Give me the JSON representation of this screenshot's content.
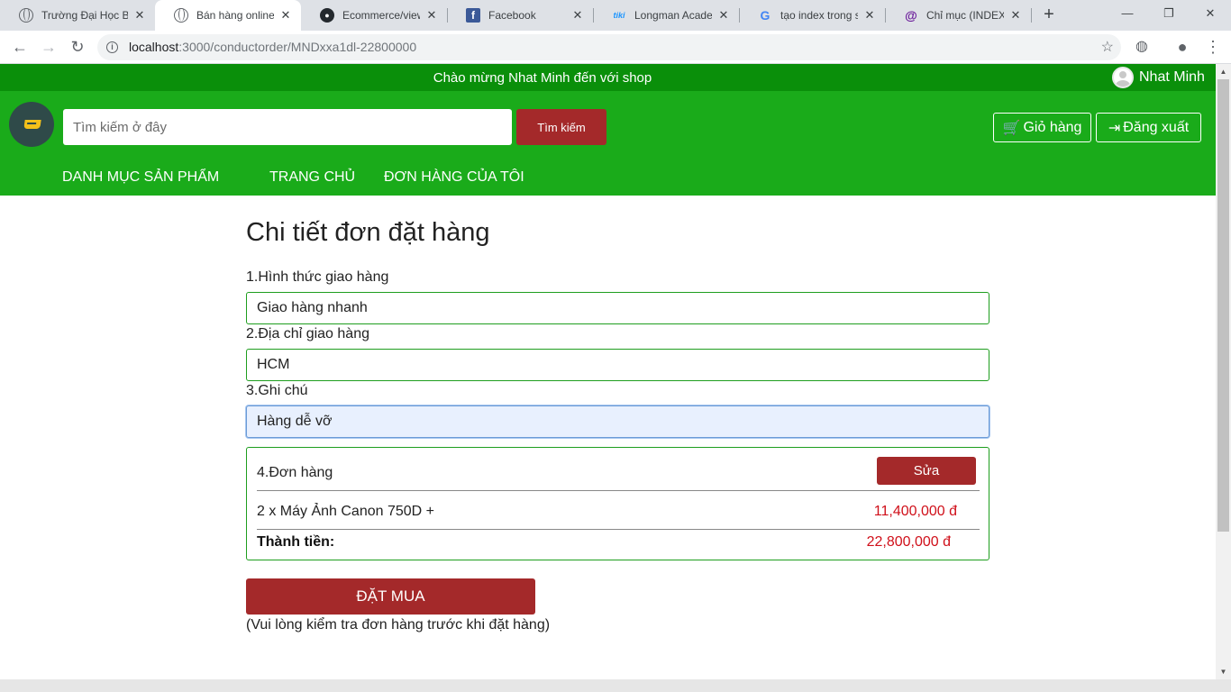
{
  "browser": {
    "tabs": [
      {
        "title": "Trường Đại Học Bá",
        "icon": "globe-icon"
      },
      {
        "title": "Bán hàng online",
        "icon": "globe-icon"
      },
      {
        "title": "Ecommerce/views",
        "icon": "github-icon"
      },
      {
        "title": "Facebook",
        "icon": "facebook-icon"
      },
      {
        "title": "Longman Academ",
        "icon": "tiki-icon"
      },
      {
        "title": "tạo index trong sq",
        "icon": "google-icon"
      },
      {
        "title": "Chỉ mục (INDEX) tr",
        "icon": "at-icon"
      }
    ],
    "url_host": "localhost",
    "url_path": ":3000/conductorder/MNDxxa1dl-22800000"
  },
  "welcome": {
    "text": "Chào mừng Nhat Minh đến với shop",
    "user_name": "Nhat Minh"
  },
  "header": {
    "search_placeholder": "Tìm kiếm ở đây",
    "search_button": "Tìm kiếm",
    "cart_button": "Giỏ hàng",
    "logout_button": "Đăng xuất",
    "nav": [
      "DANH MỤC SẢN PHẨM",
      "TRANG CHỦ",
      "ĐƠN HÀNG CỦA TÔI"
    ]
  },
  "form": {
    "title": "Chi tiết đơn đặt hàng",
    "shipping_label": "1.Hình thức giao hàng",
    "shipping_value": "Giao hàng nhanh",
    "address_label": "2.Địa chỉ giao hàng",
    "address_value": "HCM",
    "note_label": "3.Ghi chú",
    "note_value": "Hàng dễ vỡ",
    "order": {
      "title": "4.Đơn hàng",
      "edit_button": "Sửa",
      "item": "2 x Máy Ảnh Canon 750D +",
      "item_price": "11,400,000 đ",
      "total_label": "Thành tiền:",
      "total_value": "22,800,000 đ"
    },
    "buy_button": "ĐẶT MUA",
    "buy_note": "(Vui lòng kiểm tra đơn hàng trước khi đặt hàng)"
  },
  "colors": {
    "welcome_bar": "#0a8f0a",
    "header": "#1aab1a",
    "button_red": "#a4292a",
    "price_red": "#d0101a"
  }
}
